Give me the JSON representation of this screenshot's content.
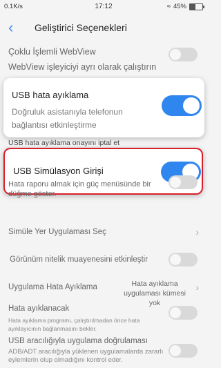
{
  "status": {
    "speed": "0.1K/s",
    "time": "17:12",
    "battery": "45%",
    "battery_level": 0.45
  },
  "header": {
    "title": "Geliştirici Seçenekleri"
  },
  "rows": {
    "multi_webview_title": "Çoklu İşlemli WebView",
    "multi_webview_sub": "WebView işleyiciyi ayrı olarak çalıştırın",
    "usb_debug_title": "USB hata ayıklama",
    "usb_debug_sub": "Doğruluk asistanıyla telefonun bağlantısı etkinleştirme",
    "usb_revoke_title": "USB hata ayıklama onayını iptal et",
    "usb_sim_title": "USB Simülasyon Girişi",
    "bugreport_title": "Hata raporu almak için güç menüsünde bir düğme göster.",
    "mock_location_title": "Simüle Yer Uygulaması Seç",
    "view_attr_title": "Görünüm nitelik muayenesini etkinleştir",
    "debug_app_title": "Uygulama Hata Ayıklama",
    "debug_app_value": "Hata ayıklama uygulaması kümesi yok",
    "wait_debugger_title": "Hata ayıklanacak",
    "wait_debugger_sub": "Hata ayıklama programı, çalıştırılmadan önce hata ayıklayıcının bağlanmasını bekler.",
    "verify_usb_title": "USB aracılığıyla uygulama doğrulaması",
    "verify_usb_sub": "ADB/ADT aracılığıyla yüklenen uygulamalarda zararlı eylemlerin olup olmadığını kontrol eder."
  },
  "colors": {
    "accent": "#2f86ee",
    "highlight_border": "#d81f2c",
    "toggle_off": "#d9d9d9"
  }
}
